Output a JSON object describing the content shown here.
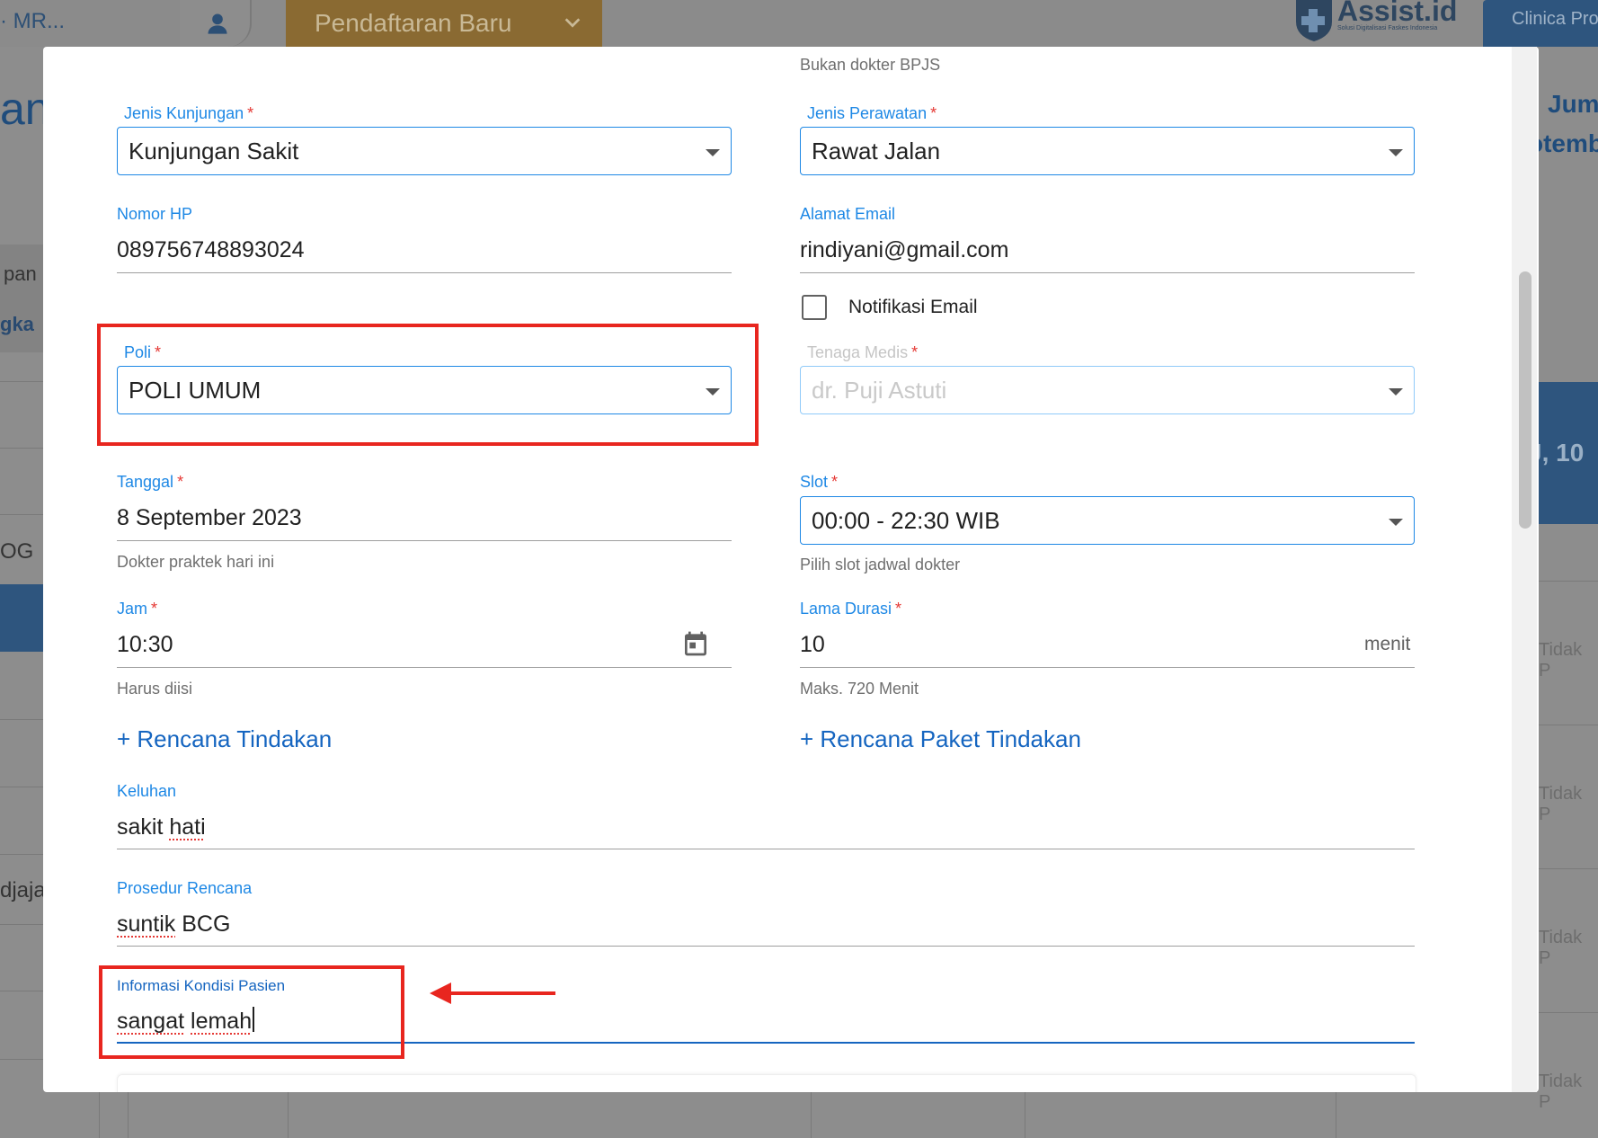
{
  "background": {
    "topbar": {
      "mr_text": "· MR...",
      "pendaftaran_label": "Pendaftaran Baru",
      "logo_text": "Assist.id",
      "logo_subtext": "Solusi Digitalisasi Faskes Indonesia",
      "clinic_label": "Clinica Pro"
    },
    "left": {
      "title_fragment": "an",
      "pan": "pan",
      "gka": "gka",
      "og": "OG",
      "djaja": "djaja"
    },
    "right": {
      "jum": "Jum",
      "tember": "otemb",
      "date_fragment": "J, 10",
      "tidak": [
        "Tidak P",
        "Tidak P",
        "Tidak P",
        "Tidak P"
      ]
    }
  },
  "form": {
    "top_hint": "Bukan dokter BPJS",
    "jenis_kunjungan": {
      "label": "Jenis Kunjungan",
      "value": "Kunjungan Sakit"
    },
    "jenis_perawatan": {
      "label": "Jenis Perawatan",
      "value": "Rawat Jalan"
    },
    "nomor_hp": {
      "label": "Nomor HP",
      "value": "089756748893024"
    },
    "alamat_email": {
      "label": "Alamat Email",
      "value": "rindiyani@gmail.com"
    },
    "notifikasi_email": {
      "label": "Notifikasi Email",
      "checked": false
    },
    "poli": {
      "label": "Poli",
      "value": "POLI UMUM"
    },
    "tenaga_medis": {
      "label": "Tenaga Medis",
      "value": "dr. Puji Astuti"
    },
    "tanggal": {
      "label": "Tanggal",
      "value": "8 September 2023",
      "hint": "Dokter praktek hari ini"
    },
    "slot": {
      "label": "Slot",
      "value": "00:00 - 22:30 WIB",
      "hint": "Pilih slot jadwal dokter"
    },
    "jam": {
      "label": "Jam",
      "value": "10:30",
      "hint": "Harus diisi"
    },
    "lama_durasi": {
      "label": "Lama Durasi",
      "value": "10",
      "suffix": "menit",
      "hint": "Maks. 720 Menit"
    },
    "rencana_tindakan": "+ Rencana Tindakan",
    "rencana_paket_tindakan": "+ Rencana Paket Tindakan",
    "keluhan": {
      "label": "Keluhan",
      "value_plain": "sakit ",
      "value_misspelled": "hati"
    },
    "prosedur_rencana": {
      "label": "Prosedur Rencana",
      "value_misspelled": "suntik",
      "value_plain": " BCG"
    },
    "informasi_kondisi": {
      "label": "Informasi Kondisi Pasien",
      "value_misspelled_1": "sangat",
      "value_plain": " ",
      "value_misspelled_2": "lemah"
    }
  },
  "colors": {
    "primary": "#1e88e5",
    "required": "#e53935",
    "annotation": "#e8261f",
    "brand_dark": "#2e557e",
    "pendaftaran": "#8a6a32"
  }
}
